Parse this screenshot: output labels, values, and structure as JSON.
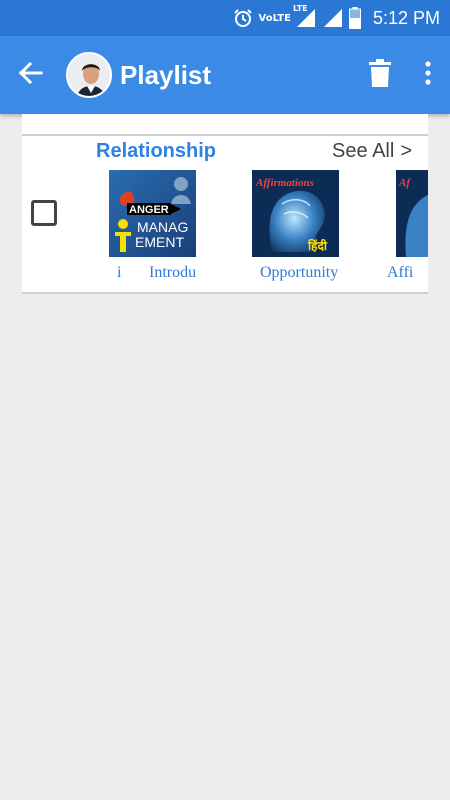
{
  "status_bar": {
    "network": "VoLTE",
    "lte": "LTE",
    "time": "5:12 PM",
    "icons": [
      "alarm-icon",
      "lte-signal-icon",
      "signal-icon",
      "battery-icon"
    ]
  },
  "app_bar": {
    "title": "Playlist",
    "background": "#3a8ae6",
    "icons": [
      "back-arrow-icon",
      "avatar",
      "delete-icon",
      "more-vert-icon"
    ]
  },
  "section": {
    "title": "Relationship",
    "see_all": "See All",
    "see_all_chevron": ">",
    "accent": "#2f82e0",
    "items": [
      {
        "label_prefix": "i",
        "label": "Introdu",
        "thumb_text_top": "ANGER",
        "thumb_text_mid": "MANAG",
        "thumb_text_bottom": "EMENT"
      },
      {
        "label": "Opportunity",
        "thumb_text_top": "Affirmations",
        "thumb_text_badge": "हिंदी"
      },
      {
        "label": "Affi",
        "thumb_text_top": "Af"
      }
    ]
  }
}
